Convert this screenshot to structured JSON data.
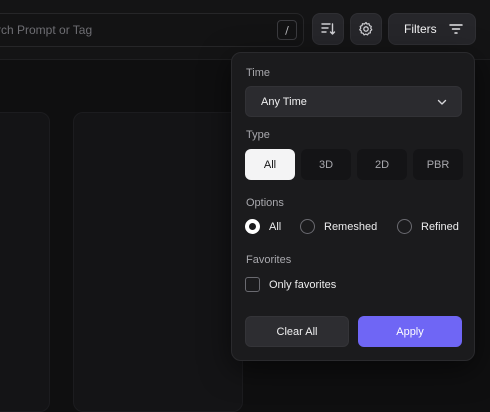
{
  "search": {
    "placeholder_visible": "rch Prompt or Tag",
    "shortcut": "/"
  },
  "toolbar": {
    "sort_icon": "sort-descending-icon",
    "settings_icon": "gear-icon",
    "filters_label": "Filters",
    "filters_icon": "filter-lines-icon"
  },
  "filters_panel": {
    "time": {
      "label": "Time",
      "selected": "Any Time"
    },
    "type": {
      "label": "Type",
      "options": [
        "All",
        "3D",
        "2D",
        "PBR"
      ],
      "selected": "All"
    },
    "options": {
      "label": "Options",
      "choices": [
        "All",
        "Remeshed",
        "Refined"
      ],
      "selected": "All"
    },
    "favorites": {
      "label": "Favorites",
      "checkbox_label": "Only favorites",
      "checked": false
    },
    "buttons": {
      "clear": "Clear All",
      "apply": "Apply"
    }
  },
  "colors": {
    "accent": "#6f66f5",
    "panel_bg": "#1b1b1d",
    "page_bg": "#0f0f10"
  }
}
